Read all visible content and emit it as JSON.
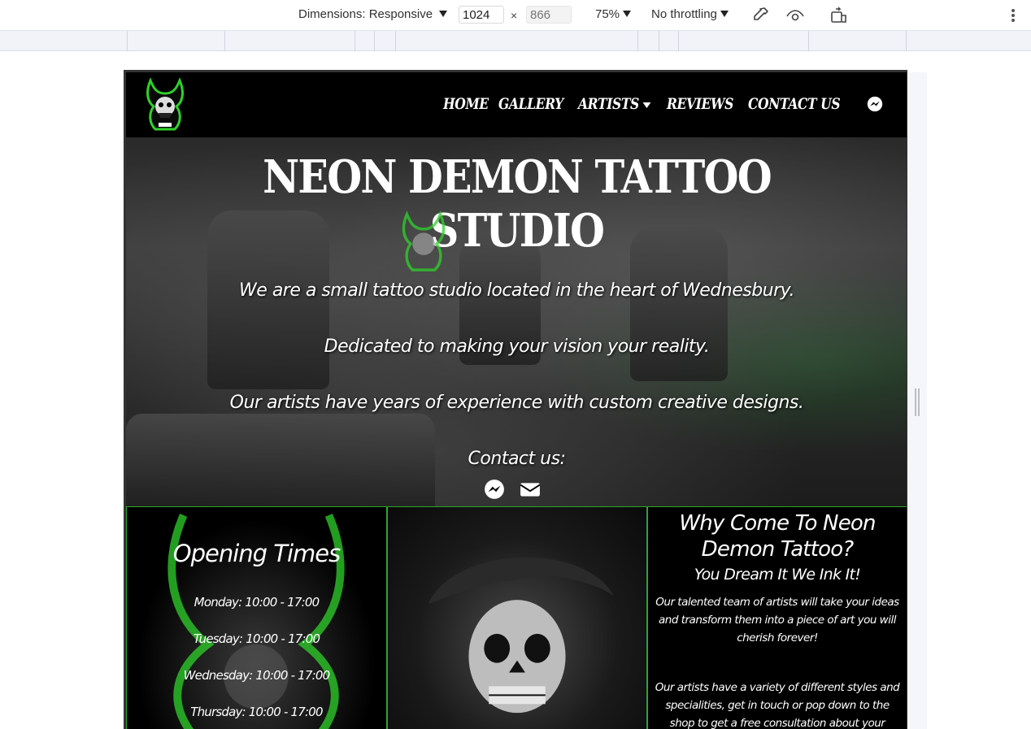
{
  "devtools": {
    "dimensions_label": "Dimensions: Responsive",
    "width_value": "1024",
    "height_placeholder": "866",
    "times_sign": "×",
    "zoom_label": "75%",
    "throttling_label": "No throttling",
    "icons": [
      "eyedropper-icon",
      "eye-icon",
      "rotate-device-icon",
      "more-options-icon"
    ]
  },
  "navbar": {
    "links": [
      "HOME",
      "GALLERY",
      "ARTISTS",
      "REVIEWS",
      "CONTACT US"
    ],
    "icons": [
      "demon-logo",
      "messenger-icon",
      "dropdown-caret-icon"
    ]
  },
  "hero": {
    "title": "NEON DEMON TATTOO STUDIO",
    "line1": "We are a small tattoo studio located in the heart of Wednesbury.",
    "line2": "Dedicated to making your vision your reality.",
    "line3": "Our artists have years of experience with custom creative designs.",
    "contact_label": "Contact us:",
    "icons": [
      "messenger-icon",
      "envelope-icon"
    ]
  },
  "opening_times": {
    "title": "Opening Times",
    "hours": [
      "Monday: 10:00 - 17:00",
      "Tuesday: 10:00 - 17:00",
      "Wednesday: 10:00 - 17:00",
      "Thursday: 10:00 - 17:00"
    ]
  },
  "why": {
    "title": "Why Come To Neon Demon Tattoo?",
    "subtitle": "You Dream It We Ink It!",
    "paragraph1": "Our talented team of artists will take your ideas and transform them into a piece of art you will cherish forever!",
    "paragraph2": "Our artists have a variety of different styles and specialities, get in touch or pop down to the shop to get a free consultation about your ideas!"
  },
  "colors": {
    "neon_green": "#2fa52b",
    "background": "#000000",
    "text": "#ffffff"
  }
}
